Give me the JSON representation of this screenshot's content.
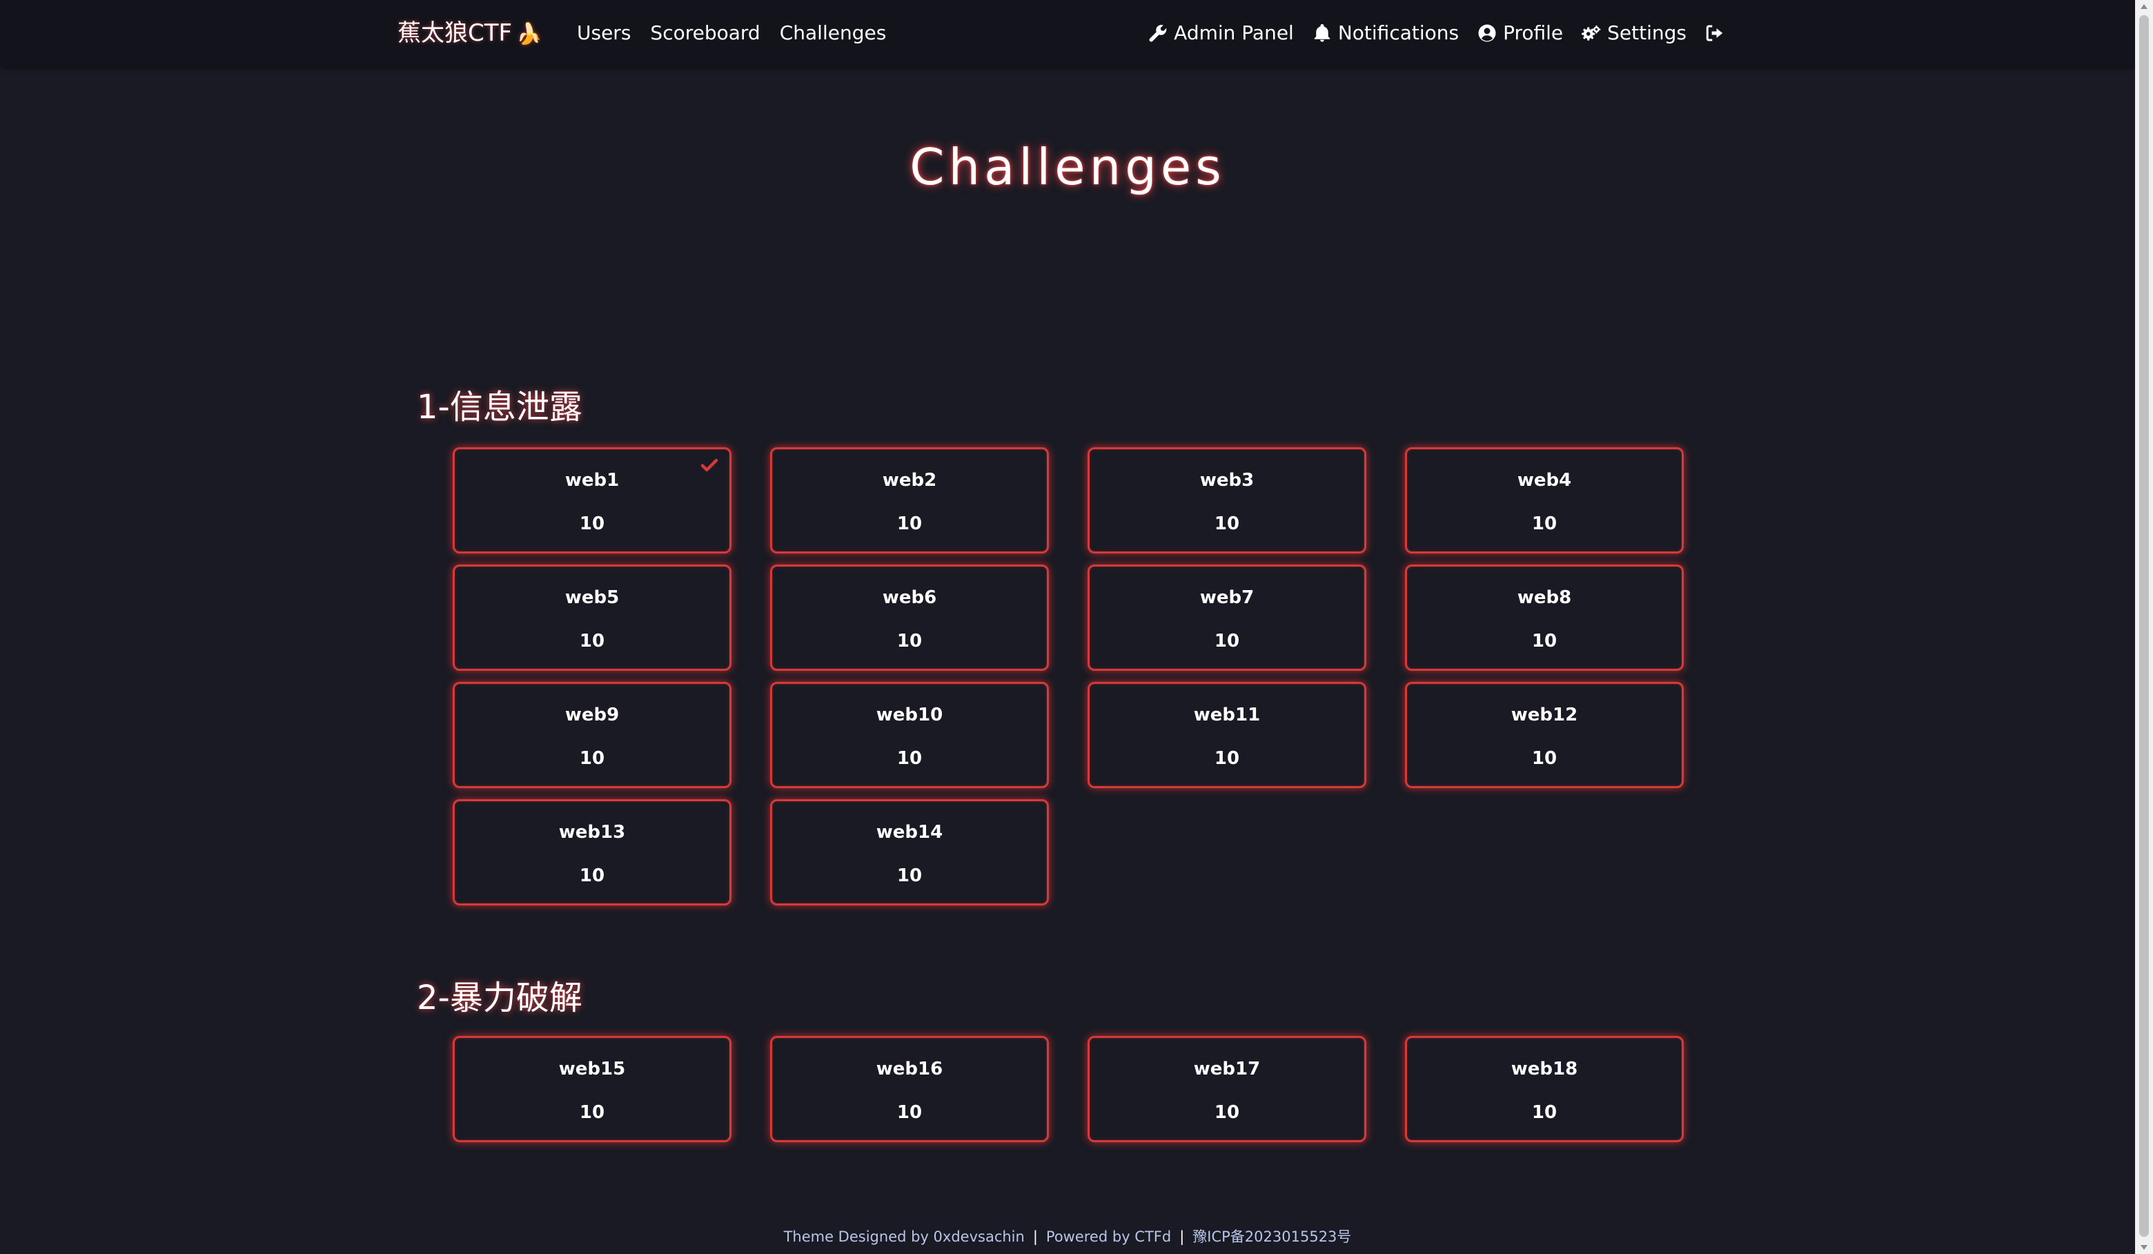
{
  "brand": {
    "name": "蕉太狼CTF",
    "emoji": "🍌"
  },
  "nav": {
    "left": [
      "Users",
      "Scoreboard",
      "Challenges"
    ],
    "right": [
      {
        "label": "Admin Panel",
        "icon": "wrench-icon"
      },
      {
        "label": "Notifications",
        "icon": "bell-icon"
      },
      {
        "label": "Profile",
        "icon": "user-circle-icon"
      },
      {
        "label": "Settings",
        "icon": "gears-icon"
      },
      {
        "label": "",
        "icon": "logout-icon"
      }
    ]
  },
  "page_title": "Challenges",
  "categories": [
    {
      "title": "1-信息泄露",
      "challenges": [
        {
          "name": "web1",
          "points": "10",
          "solved": true
        },
        {
          "name": "web2",
          "points": "10",
          "solved": false
        },
        {
          "name": "web3",
          "points": "10",
          "solved": false
        },
        {
          "name": "web4",
          "points": "10",
          "solved": false
        },
        {
          "name": "web5",
          "points": "10",
          "solved": false
        },
        {
          "name": "web6",
          "points": "10",
          "solved": false
        },
        {
          "name": "web7",
          "points": "10",
          "solved": false
        },
        {
          "name": "web8",
          "points": "10",
          "solved": false
        },
        {
          "name": "web9",
          "points": "10",
          "solved": false
        },
        {
          "name": "web10",
          "points": "10",
          "solved": false
        },
        {
          "name": "web11",
          "points": "10",
          "solved": false
        },
        {
          "name": "web12",
          "points": "10",
          "solved": false
        },
        {
          "name": "web13",
          "points": "10",
          "solved": false
        },
        {
          "name": "web14",
          "points": "10",
          "solved": false
        }
      ]
    },
    {
      "title": "2-暴力破解",
      "challenges": [
        {
          "name": "web15",
          "points": "10",
          "solved": false
        },
        {
          "name": "web16",
          "points": "10",
          "solved": false
        },
        {
          "name": "web17",
          "points": "10",
          "solved": false
        },
        {
          "name": "web18",
          "points": "10",
          "solved": false
        }
      ]
    }
  ],
  "footer": {
    "theme": "Theme Designed by 0xdevsachin",
    "powered": "Powered by CTFd",
    "icp": "豫ICP备2023015523号",
    "separator": "|"
  },
  "colors": {
    "background": "#191a23",
    "navbar": "#13141b",
    "accent": "#d43a3a",
    "footer_text": "#b8c4e8"
  }
}
